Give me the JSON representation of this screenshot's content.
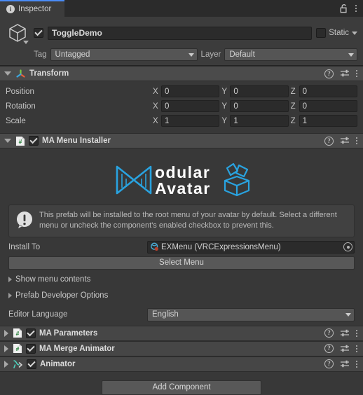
{
  "window": {
    "tab_label": "Inspector",
    "tab_icon": "info-icon",
    "lock_icon": "lock-open-icon",
    "menu_icon": "kebab-menu-icon",
    "accent_color": "#4a8cf7",
    "background": "#383838"
  },
  "gameobject": {
    "icon": "cube-icon",
    "enabled": true,
    "name": "ToggleDemo",
    "static_label": "Static",
    "static_checked": false,
    "tag_label": "Tag",
    "tag_value": "Untagged",
    "layer_label": "Layer",
    "layer_value": "Default"
  },
  "components": [
    {
      "name": "transform",
      "title": "Transform",
      "icon": "transform-gizmo-icon",
      "expanded": true,
      "has_checkbox": false,
      "rows": [
        {
          "label": "Position",
          "x": "0",
          "y": "0",
          "z": "0"
        },
        {
          "label": "Rotation",
          "x": "0",
          "y": "0",
          "z": "0"
        },
        {
          "label": "Scale",
          "x": "1",
          "y": "1",
          "z": "1"
        }
      ],
      "axis_labels": {
        "x": "X",
        "y": "Y",
        "z": "Z"
      }
    },
    {
      "name": "ma-menu-installer",
      "title": "MA Menu Installer",
      "icon": "csharp-script-icon",
      "expanded": true,
      "has_checkbox": true,
      "enabled": true
    },
    {
      "name": "ma-parameters",
      "title": "MA Parameters",
      "icon": "csharp-script-icon",
      "expanded": false,
      "has_checkbox": true,
      "enabled": true
    },
    {
      "name": "ma-merge-animator",
      "title": "MA Merge Animator",
      "icon": "csharp-script-icon",
      "expanded": false,
      "has_checkbox": true,
      "enabled": true
    },
    {
      "name": "animator",
      "title": "Animator",
      "icon": "animator-icon",
      "expanded": false,
      "has_checkbox": true,
      "enabled": true
    }
  ],
  "installer": {
    "logo": {
      "line1": "odular",
      "line2": "Avatar",
      "monogram": "M",
      "brand_color": "#29a3e0"
    },
    "helpbox": {
      "icon": "warning-exclamation-icon",
      "text": "This prefab will be installed to the root menu of your avatar by default. Select a different menu or uncheck the component's enabled checkbox to prevent this."
    },
    "install_to_label": "Install To",
    "install_to_value": "EXMenu (VRCExpressionsMenu)",
    "install_to_icon": "vrc-expressions-menu-asset-icon",
    "object_picker_icon": "object-picker-icon",
    "select_menu_button": "Select Menu",
    "foldouts": [
      {
        "label": "Show menu contents",
        "expanded": false
      },
      {
        "label": "Prefab Developer Options",
        "expanded": false
      }
    ],
    "editor_language_label": "Editor Language",
    "editor_language_value": "English"
  },
  "footer": {
    "add_component_label": "Add Component"
  },
  "component_header_icons": {
    "help": "help-icon",
    "preset": "preset-slider-icon",
    "menu": "kebab-menu-icon"
  }
}
